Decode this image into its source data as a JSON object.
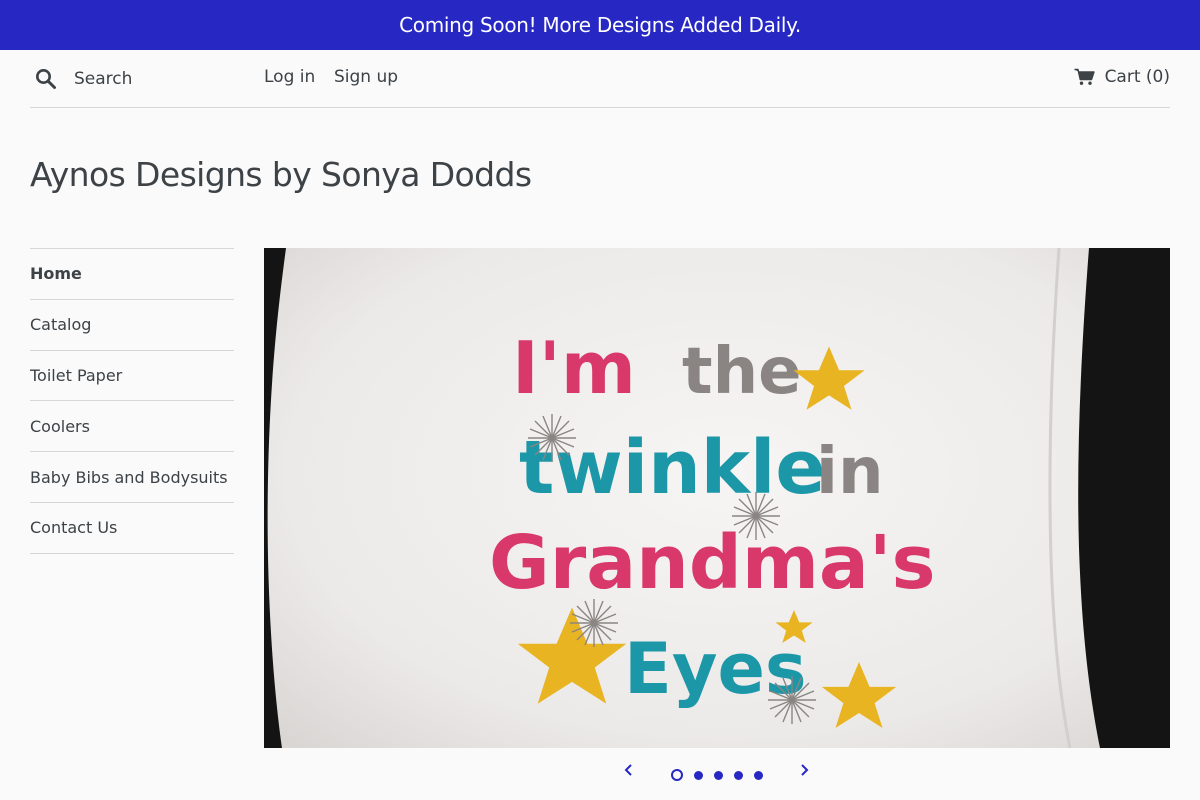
{
  "announcement": {
    "text": "Coming Soon! More Designs Added Daily."
  },
  "header": {
    "search_placeholder": "Search",
    "login_label": "Log in",
    "signup_label": "Sign up",
    "cart_label": "Cart (0)"
  },
  "site": {
    "title": "Aynos Designs by Sonya Dodds"
  },
  "sidebar": {
    "items": [
      {
        "label": "Home",
        "active": true
      },
      {
        "label": "Catalog"
      },
      {
        "label": "Toilet Paper"
      },
      {
        "label": "Coolers"
      },
      {
        "label": "Baby Bibs and Bodysuits"
      },
      {
        "label": "Contact Us"
      }
    ]
  },
  "slideshow": {
    "slide_text": {
      "line1a": "I'm",
      "line1b": "the",
      "line2a": "twinkle",
      "line2b": "in",
      "line3": "Grandma's",
      "line4": "Eyes"
    },
    "slide_count": 5,
    "current_slide": 1
  },
  "colors": {
    "accent": "#2727c4",
    "text": "#3d4246",
    "pink": "#d9386a",
    "teal": "#1c97a8",
    "gray_thread": "#8a8582",
    "gold_star": "#e8b421"
  }
}
